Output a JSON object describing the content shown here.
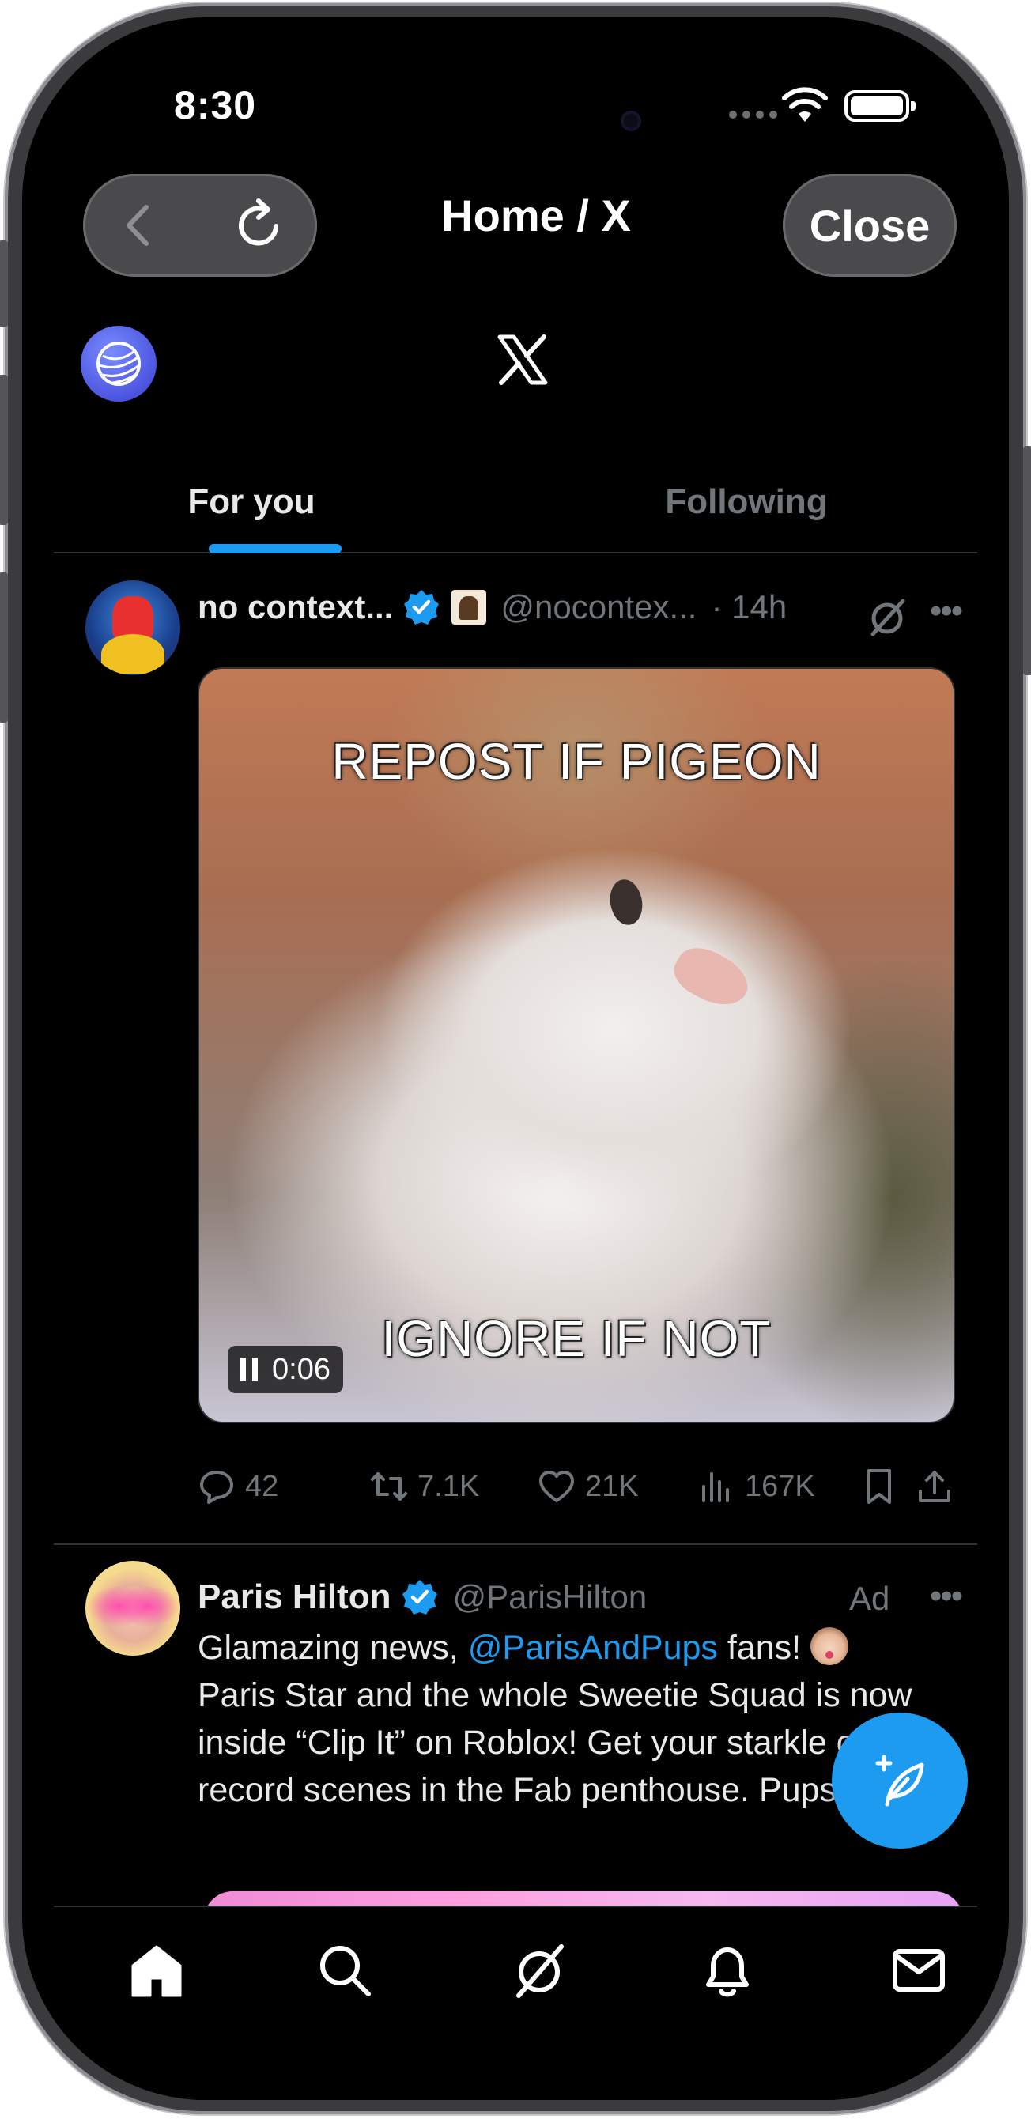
{
  "status_bar": {
    "time": "8:30"
  },
  "browser": {
    "title": "Home / X",
    "close_label": "Close"
  },
  "tabs": [
    {
      "label": "For you",
      "active": true
    },
    {
      "label": "Following",
      "active": false
    }
  ],
  "tweets": [
    {
      "display_name": "no context...",
      "handle": "@nocontex...",
      "time": "· 14h",
      "media": {
        "caption_top": "REPOST IF PIGEON",
        "caption_bottom": "IGNORE IF NOT",
        "video_time": "0:06"
      },
      "stats": {
        "replies": "42",
        "reposts": "7.1K",
        "likes": "21K",
        "views": "167K"
      }
    },
    {
      "display_name": "Paris Hilton",
      "handle": "@ParisHilton",
      "ad_label": "Ad",
      "text_before_mention": "Glamazing news, ",
      "mention": "@ParisAndPups",
      "text_after_mention": " fans! ",
      "text_rest": "Paris Star and the whole Sweetie Squad is now inside “Clip It” on Roblox! Get your starkle on and record scenes in the Fab penthouse. Pupsessed!"
    }
  ],
  "icons": {
    "back": "chevron-left-icon",
    "reload": "reload-icon",
    "x_logo": "x-logo-icon",
    "compose": "compose-post-icon",
    "nav": [
      "home-icon",
      "search-icon",
      "grok-icon",
      "notifications-icon",
      "messages-icon"
    ]
  },
  "colors": {
    "accent": "#1d9bf0",
    "background": "#000000",
    "muted_text": "#71767b",
    "text": "#e7e9ea"
  }
}
